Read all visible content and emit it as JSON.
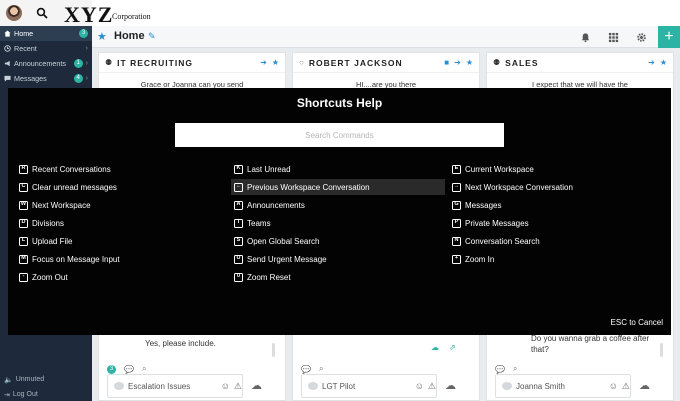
{
  "brand": {
    "logo_text": "XYZ",
    "logo_sub": "Corporation"
  },
  "sidebar": {
    "items": [
      {
        "label": "Home",
        "badge": "3",
        "active": true
      },
      {
        "label": "Recent",
        "badge": "",
        "active": false
      },
      {
        "label": "Announcements",
        "badge": "1",
        "active": false
      },
      {
        "label": "Messages",
        "badge": "4",
        "active": false
      }
    ],
    "unmuted": "Unmuted",
    "logout": "Log Out"
  },
  "page": {
    "title": "Home"
  },
  "columns": [
    {
      "title": "IT RECRUITING",
      "message": "Grace or Joanna can you send",
      "lower_message": "Yes, please include.",
      "badge": "3",
      "input": "Escalation Issues"
    },
    {
      "title": "ROBERT JACKSON",
      "message": "HI....are you there",
      "lower_message": "",
      "badge": "",
      "input": "LGT Pilot"
    },
    {
      "title": "SALES",
      "message": "I expect that we will have the",
      "lower_message": "Do you wanna grab a coffee after that?",
      "badge": "",
      "input": "Joanna Smith"
    }
  ],
  "overlay": {
    "title": "Shortcuts Help",
    "search_placeholder": "Search Commands",
    "cancel": "ESC to Cancel",
    "shortcuts": [
      {
        "key": "R",
        "label": "Recent Conversations"
      },
      {
        "key": "K",
        "label": "Last Unread"
      },
      {
        "key": "E",
        "label": "Current Workspace"
      },
      {
        "key": "C",
        "label": "Clear unread messages"
      },
      {
        "key": "←",
        "label": "Previous Workspace Conversation"
      },
      {
        "key": "→",
        "label": "Next Workspace Conversation"
      },
      {
        "key": "W",
        "label": "Next Workspace"
      },
      {
        "key": "A",
        "label": "Announcements"
      },
      {
        "key": "G",
        "label": "Messages"
      },
      {
        "key": "D",
        "label": "Divisions"
      },
      {
        "key": "T",
        "label": "Teams"
      },
      {
        "key": "P",
        "label": "Private Messages"
      },
      {
        "key": "L",
        "label": "Upload File"
      },
      {
        "key": "S",
        "label": "Open Global Search"
      },
      {
        "key": "N",
        "label": "Conversation Search"
      },
      {
        "key": "M",
        "label": "Focus on Message Input"
      },
      {
        "key": "U",
        "label": "Send Urgent Message"
      },
      {
        "key": "+",
        "label": "Zoom In"
      },
      {
        "key": "-",
        "label": "Zoom Out"
      },
      {
        "key": "0",
        "label": "Zoom Reset"
      }
    ]
  },
  "colors": {
    "accent": "#2bb3a3",
    "link": "#2a8fd0",
    "sidebar": "#1e2a3b",
    "overlay": "#030303"
  }
}
